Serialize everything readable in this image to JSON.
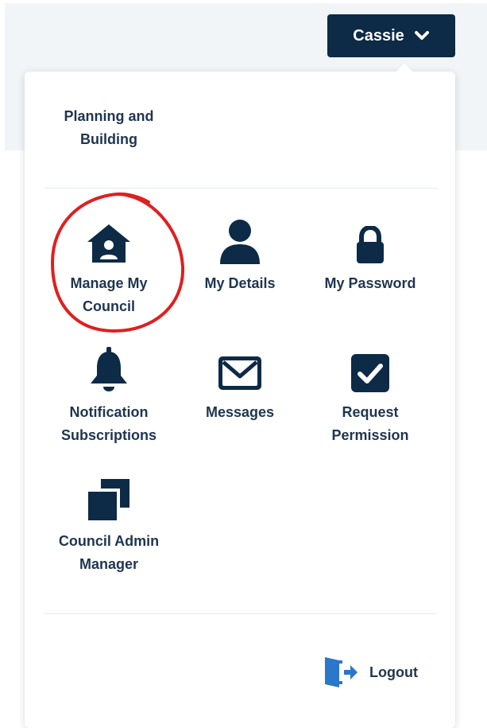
{
  "header": {
    "user_name": "Cassie",
    "user_icon": "chevron-down-icon"
  },
  "menu": {
    "top_link": "Planning and Building",
    "tiles": [
      {
        "label": "Manage My Council",
        "icon": "house-user-icon"
      },
      {
        "label": "My Details",
        "icon": "user-icon"
      },
      {
        "label": "My Password",
        "icon": "lock-icon"
      },
      {
        "label": "Notification Subscriptions",
        "icon": "bell-icon"
      },
      {
        "label": "Messages",
        "icon": "envelope-icon"
      },
      {
        "label": "Request Permission",
        "icon": "checkbox-icon"
      },
      {
        "label": "Council Admin Manager",
        "icon": "copy-icon"
      }
    ],
    "logout_label": "Logout",
    "logout_icon": "logout-icon"
  },
  "colors": {
    "navy": "#0d2a47",
    "text": "#1f3550",
    "annotation": "#e01f1f",
    "logout_icon": "#2b77c9"
  }
}
